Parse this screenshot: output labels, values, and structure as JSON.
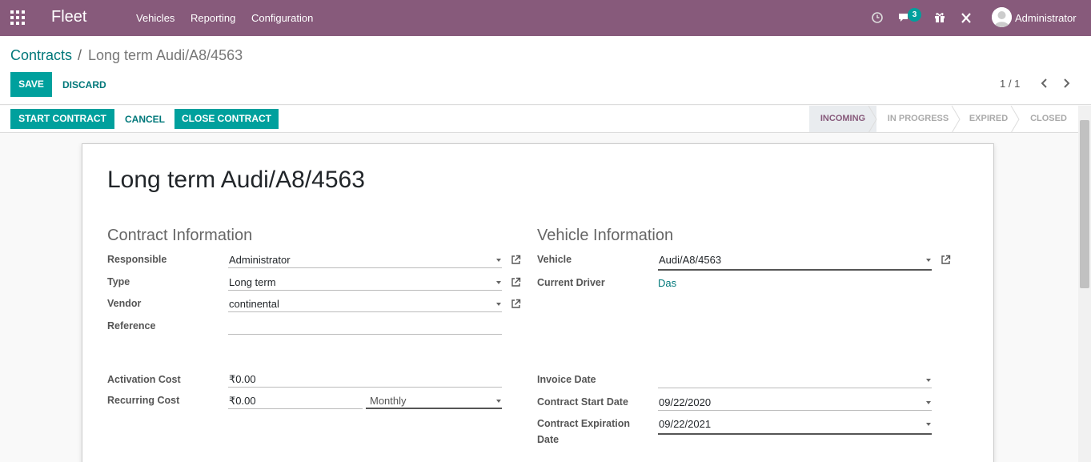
{
  "navbar": {
    "brand": "Fleet",
    "menu": [
      "Vehicles",
      "Reporting",
      "Configuration"
    ],
    "chat_count": "3",
    "user": "Administrator",
    "icons": [
      "apps-grid-icon",
      "clock-icon",
      "chat-icon",
      "gift-icon",
      "tools-icon"
    ]
  },
  "breadcrumb": {
    "parent": "Contracts",
    "separator": "/",
    "current": "Long term Audi/A8/4563"
  },
  "actions": {
    "save": "SAVE",
    "discard": "DISCARD"
  },
  "pager": {
    "value": "1 / 1"
  },
  "header_buttons": {
    "start": "START CONTRACT",
    "cancel": "CANCEL",
    "close": "CLOSE CONTRACT"
  },
  "stages": [
    {
      "label": "INCOMING",
      "active": true
    },
    {
      "label": "IN PROGRESS",
      "active": false
    },
    {
      "label": "EXPIRED",
      "active": false
    },
    {
      "label": "CLOSED",
      "active": false
    }
  ],
  "record": {
    "title": "Long term Audi/A8/4563"
  },
  "contract_info": {
    "heading": "Contract Information",
    "responsible_label": "Responsible",
    "responsible": "Administrator",
    "type_label": "Type",
    "type": "Long term",
    "vendor_label": "Vendor",
    "vendor": "continental",
    "reference_label": "Reference",
    "reference": "",
    "activation_cost_label": "Activation Cost",
    "activation_cost": "₹0.00",
    "recurring_cost_label": "Recurring Cost",
    "recurring_cost": "₹0.00",
    "recurring_period": "Monthly"
  },
  "vehicle_info": {
    "heading": "Vehicle Information",
    "vehicle_label": "Vehicle",
    "vehicle": "Audi/A8/4563",
    "driver_label": "Current Driver",
    "driver": "Das",
    "invoice_date_label": "Invoice Date",
    "invoice_date": "",
    "start_date_label": "Contract Start Date",
    "start_date": "09/22/2020",
    "expiration_label_line1": "Contract Expiration",
    "expiration_label_line2": "Date",
    "expiration_date": "09/22/2021"
  },
  "colors": {
    "navbar": "#875a7b",
    "primary": "#00a09d",
    "link": "#00787a"
  }
}
